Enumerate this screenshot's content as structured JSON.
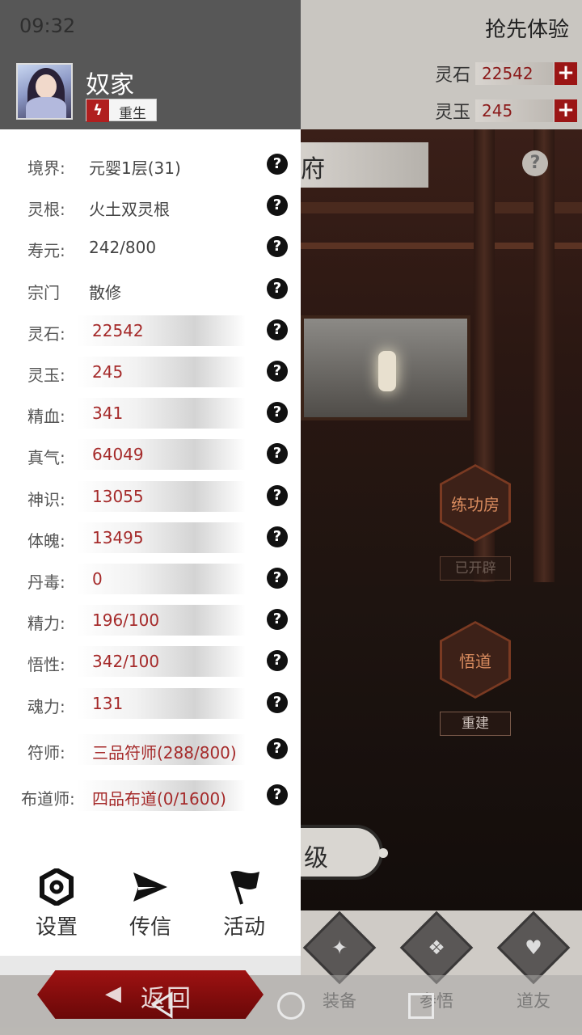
{
  "status_bar": {
    "time": "09:32"
  },
  "scene": {
    "header_title": "抢先体验",
    "resources": [
      {
        "label": "灵石",
        "value": "22542"
      },
      {
        "label": "灵玉",
        "value": "245"
      }
    ],
    "banner_title": "府",
    "training_room": {
      "label": "练功房",
      "status": "已开辟"
    },
    "enlightenment": {
      "label": "悟道",
      "status": "重建"
    },
    "level_button": "级",
    "bottom_tabs": [
      {
        "label": "装备"
      },
      {
        "label": "参悟"
      },
      {
        "label": "道友"
      }
    ],
    "colors": {
      "accent_red": "#9b1515",
      "hex_border": "#7a3a22",
      "hex_text": "#d88b5e"
    }
  },
  "drawer": {
    "player": {
      "name": "奴家",
      "tag": "重生"
    },
    "stats": [
      {
        "label": "境界:",
        "value": "元婴1层(31)",
        "style": "plain"
      },
      {
        "label": "灵根:",
        "value": "火土双灵根",
        "style": "plain"
      },
      {
        "label": "寿元:",
        "value": "242/800",
        "style": "plain"
      },
      {
        "label": "宗门",
        "value": "散修",
        "style": "plain"
      },
      {
        "label": "灵石:",
        "value": "22542",
        "style": "bar"
      },
      {
        "label": "灵玉:",
        "value": "245",
        "style": "bar"
      },
      {
        "label": "精血:",
        "value": "341",
        "style": "bar"
      },
      {
        "label": "真气:",
        "value": "64049",
        "style": "bar"
      },
      {
        "label": "神识:",
        "value": "13055",
        "style": "bar"
      },
      {
        "label": "体魄:",
        "value": "13495",
        "style": "bar"
      },
      {
        "label": "丹毒:",
        "value": "0",
        "style": "bar"
      },
      {
        "label": "精力:",
        "value": "196/100",
        "style": "bar"
      },
      {
        "label": "悟性:",
        "value": "342/100",
        "style": "bar"
      },
      {
        "label": "魂力:",
        "value": "131",
        "style": "bar"
      },
      {
        "label": "符师:",
        "value": "三品符师(288/800)",
        "style": "bar"
      },
      {
        "label": "布道师:",
        "value": "四品布道(0/1600)",
        "style": "bar"
      }
    ],
    "help_symbol": "?",
    "menu": [
      {
        "label": "设置",
        "icon": "gear-icon"
      },
      {
        "label": "传信",
        "icon": "send-icon"
      },
      {
        "label": "活动",
        "icon": "flag-icon"
      }
    ],
    "back_label": "返回"
  }
}
